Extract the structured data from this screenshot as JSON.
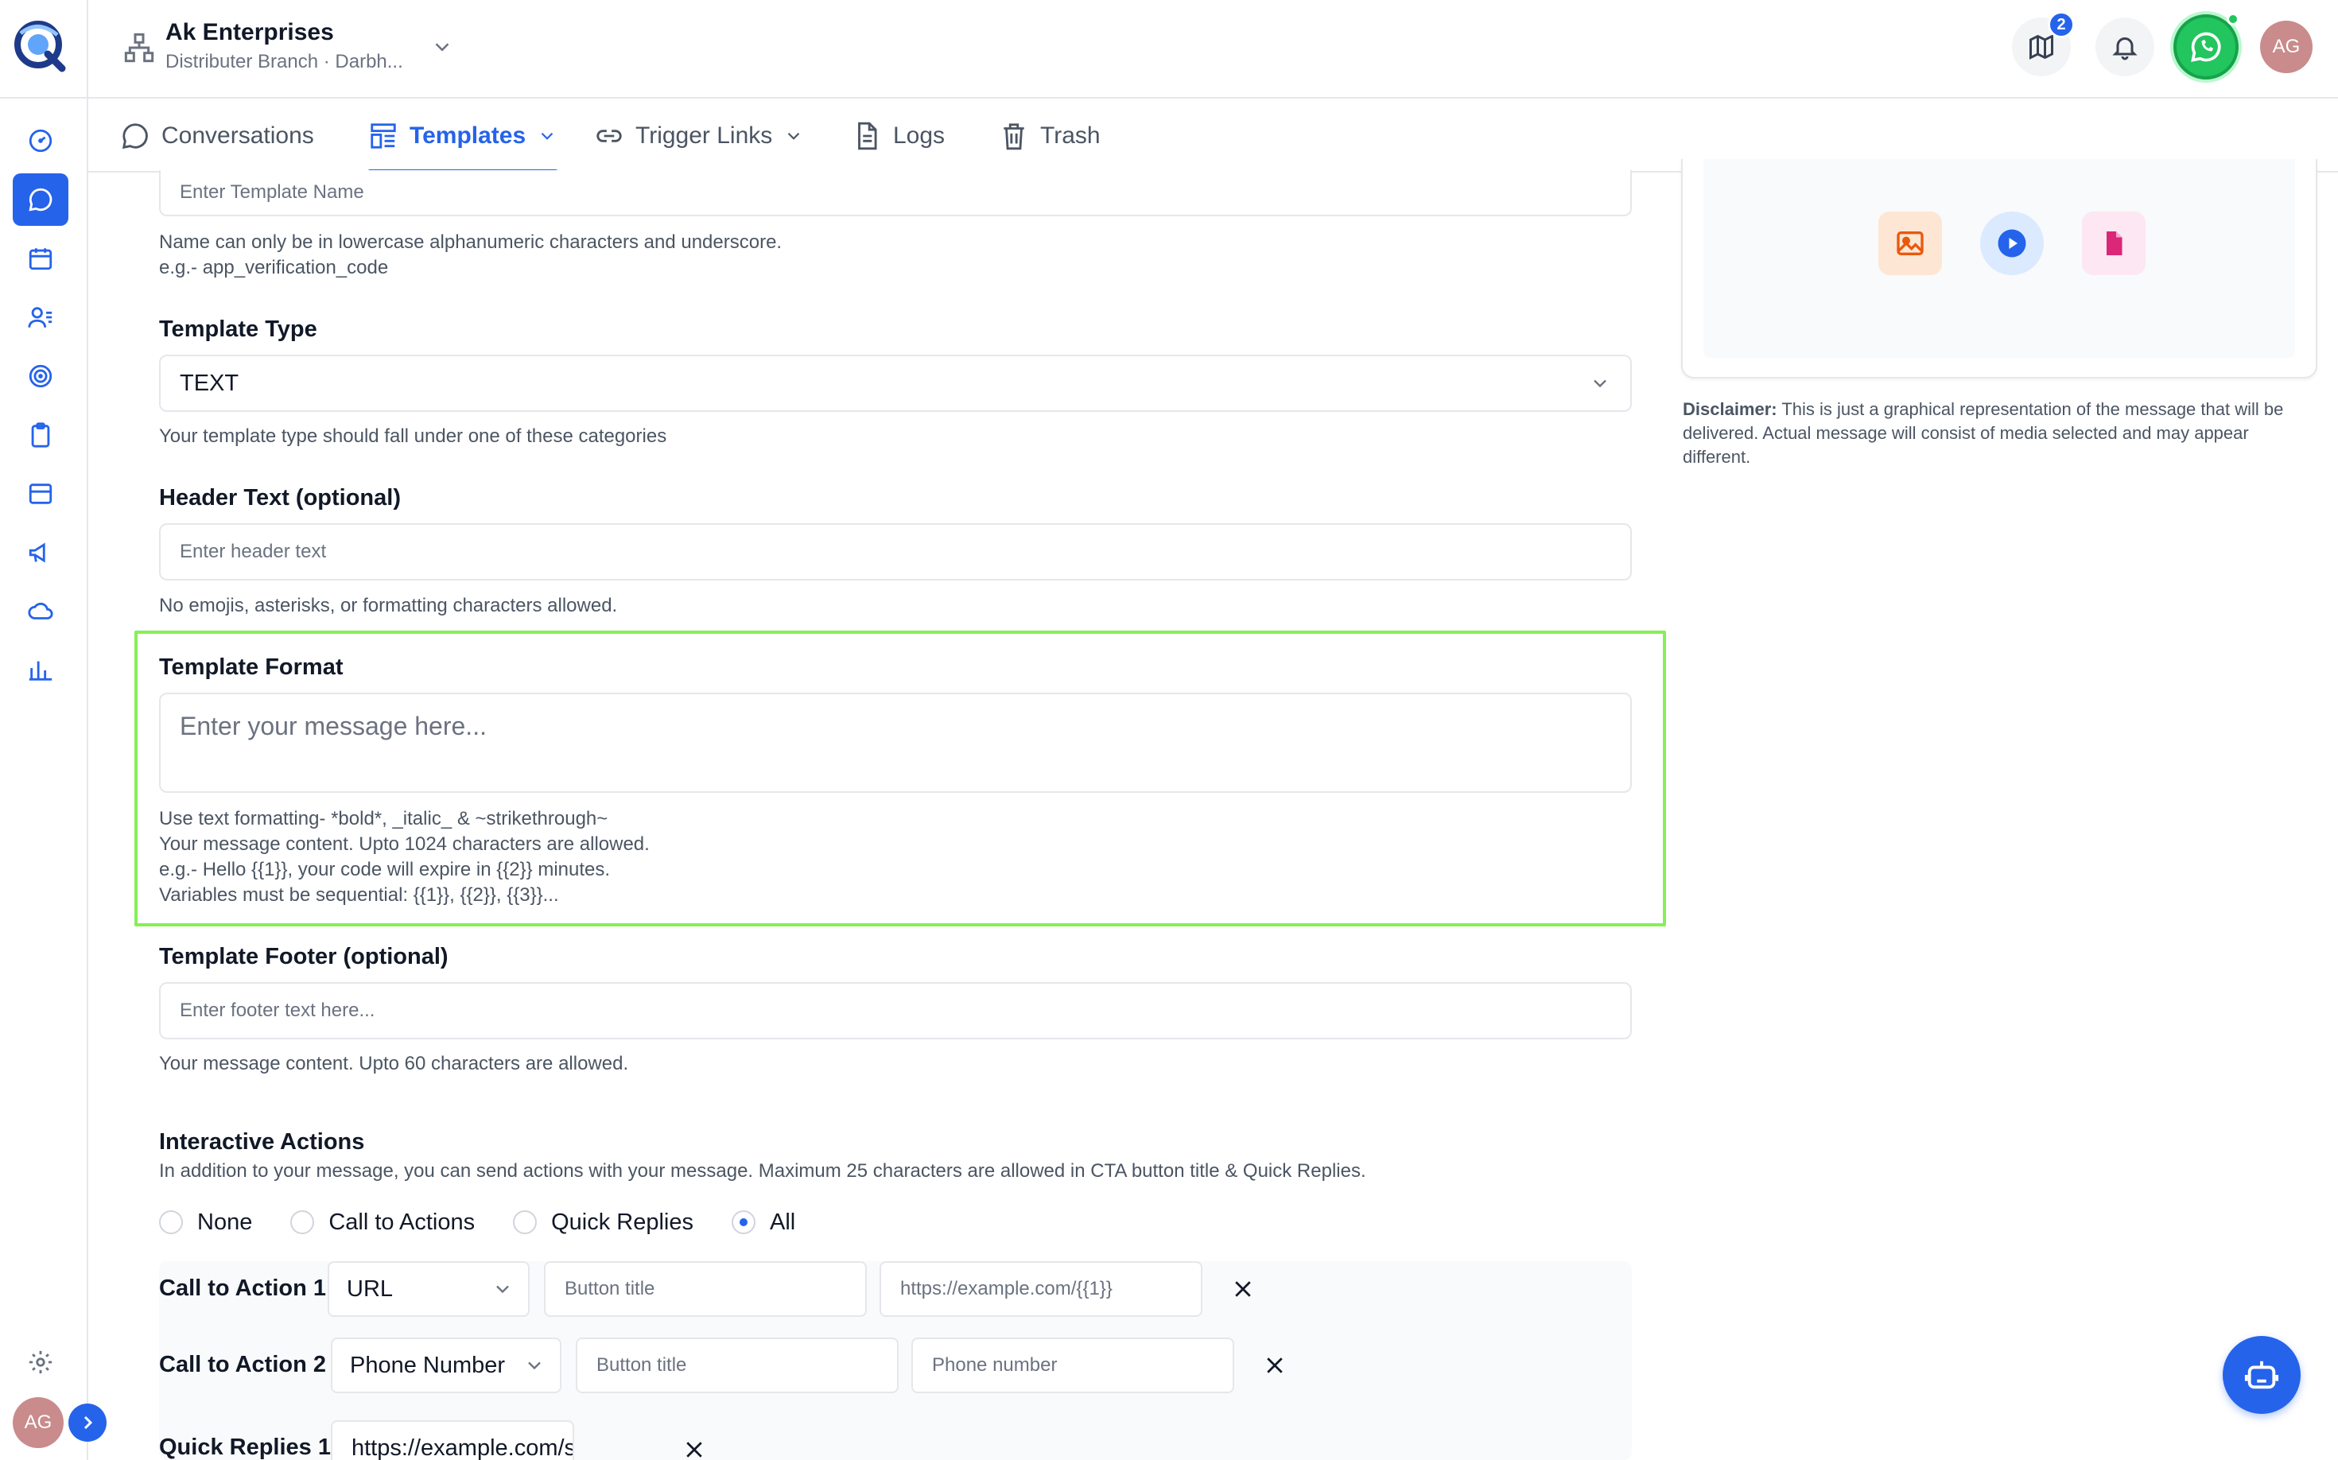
{
  "org": {
    "name": "Ak Enterprises",
    "subtitle": "Distributer Branch · Darbh..."
  },
  "top": {
    "notification_count": "2",
    "avatar_initials": "AG"
  },
  "rail": {
    "avatar_initials": "AG",
    "active_item": "conversations"
  },
  "tabs": [
    {
      "label": "Conversations",
      "icon": "chat-bubble-icon",
      "active": false
    },
    {
      "label": "Templates",
      "icon": "template-icon",
      "active": true
    },
    {
      "label": "Trigger Links",
      "icon": "link-icon",
      "active": false
    },
    {
      "label": "Logs",
      "icon": "document-icon",
      "active": false
    },
    {
      "label": "Trash",
      "icon": "trash-icon",
      "active": false
    }
  ],
  "form": {
    "name": {
      "placeholder": "Enter Template Name",
      "help1": "Name can only be in lowercase alphanumeric characters and underscore.",
      "help2": "e.g.- app_verification_code"
    },
    "type": {
      "label": "Template Type",
      "value": "TEXT",
      "help": "Your template type should fall under one of these categories"
    },
    "header": {
      "label": "Header Text (optional)",
      "placeholder": "Enter header text",
      "help": "No emojis, asterisks, or formatting characters allowed."
    },
    "format": {
      "label": "Template Format",
      "placeholder": "Enter your message here...",
      "help1": "Use text formatting- *bold*, _italic_ & ~strikethrough~",
      "help2": "Your message content. Upto 1024 characters are allowed.",
      "help3": "e.g.- Hello {{1}}, your code will expire in {{2}} minutes.",
      "help4": "Variables must be sequential: {{1}}, {{2}}, {{3}}..."
    },
    "footer": {
      "label": "Template Footer (optional)",
      "placeholder": "Enter footer text here...",
      "help": "Your message content. Upto 60 characters are allowed."
    },
    "actions": {
      "label": "Interactive Actions",
      "help": "In addition to your message, you can send actions with your message. Maximum 25 characters are allowed in CTA button title & Quick Replies.",
      "options": [
        "None",
        "Call to Actions",
        "Quick Replies",
        "All"
      ],
      "selected": "All"
    },
    "cta1": {
      "label": "Call to Action 1",
      "type": "URL",
      "title_placeholder": "Button title",
      "value_placeholder": "https://example.com/{{1}}"
    },
    "cta2": {
      "label": "Call to Action 2",
      "type": "Phone Number",
      "title_placeholder": "Button title",
      "value_placeholder": "Phone number"
    },
    "qr1": {
      "label": "Quick Replies 1",
      "value": "https://example.com/sale"
    }
  },
  "preview": {
    "disclaimer_title": "Disclaimer:",
    "disclaimer_text": "This is just a graphical representation of the message that will be delivered. Actual message will consist of media selected and may appear different.",
    "media_icons": [
      "image-icon",
      "video-play-icon",
      "document-icon"
    ]
  }
}
